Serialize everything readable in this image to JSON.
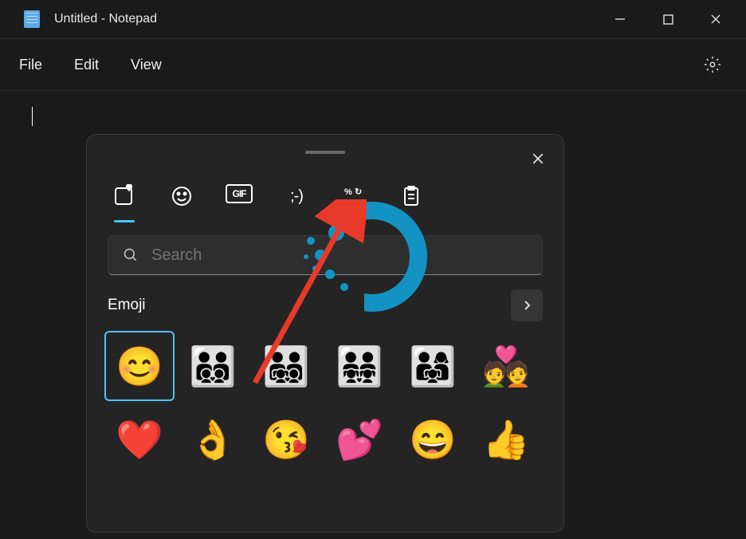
{
  "window": {
    "title": "Untitled - Notepad"
  },
  "menubar": {
    "items": [
      "File",
      "Edit",
      "View"
    ]
  },
  "emoji_panel": {
    "search_placeholder": "Search",
    "section_title": "Emoji",
    "tabs": [
      {
        "name": "recents",
        "glyph": "recents",
        "active": true
      },
      {
        "name": "emoji",
        "glyph": "smile",
        "active": false
      },
      {
        "name": "gif",
        "glyph": "GIF",
        "active": false
      },
      {
        "name": "kaomoji",
        "glyph": ";-)",
        "active": false
      },
      {
        "name": "symbols",
        "glyph": "symbols",
        "active": false
      },
      {
        "name": "clipboard",
        "glyph": "clipboard",
        "active": false
      }
    ],
    "grid": [
      {
        "e": "😊",
        "selected": true
      },
      {
        "e": "👨‍👨‍👦‍👦",
        "selected": false
      },
      {
        "e": "👨‍👨‍👧‍👦",
        "selected": false
      },
      {
        "e": "👨‍👨‍👧‍👧",
        "selected": false
      },
      {
        "e": "👨‍👩‍👧",
        "selected": false
      },
      {
        "e": "💑",
        "selected": false
      },
      {
        "e": "❤️",
        "selected": false
      },
      {
        "e": "👌",
        "selected": false
      },
      {
        "e": "😘",
        "selected": false
      },
      {
        "e": "💕",
        "selected": false
      },
      {
        "e": "😄",
        "selected": false
      },
      {
        "e": "👍",
        "selected": false
      }
    ]
  }
}
